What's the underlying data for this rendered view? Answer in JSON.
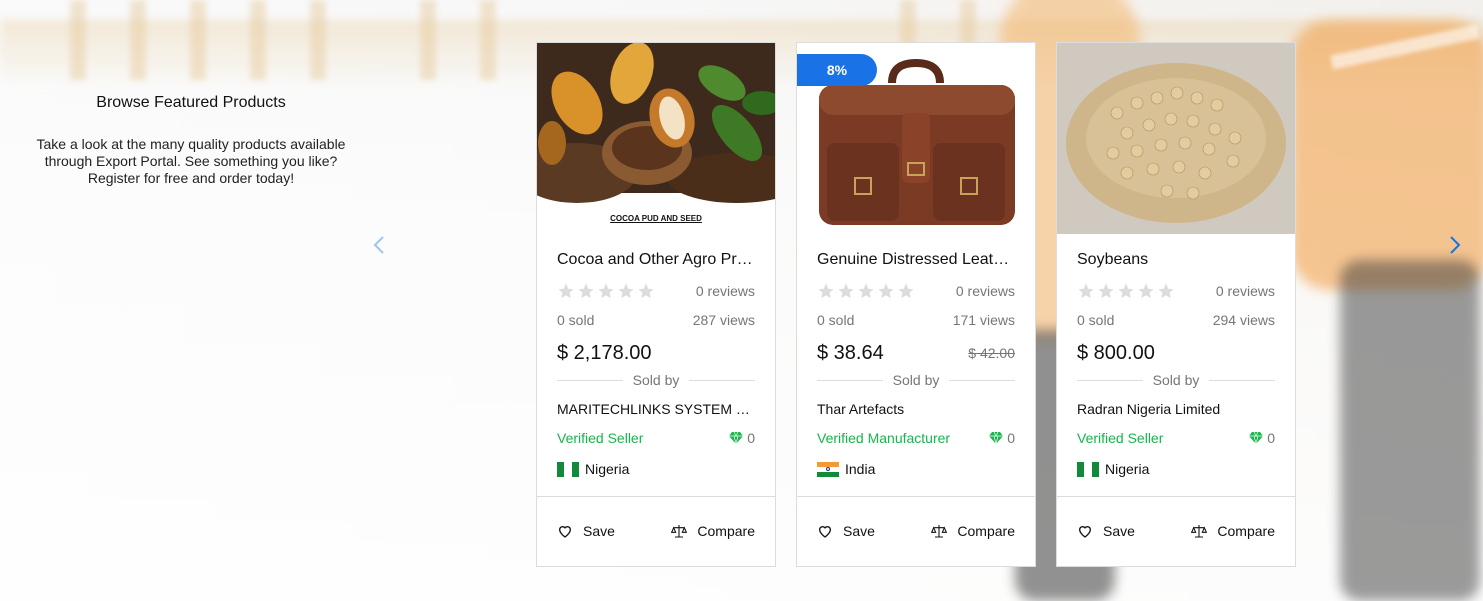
{
  "intro": {
    "title": "Browse Featured Products",
    "text": "Take a look at the many quality products available through Export Portal. See something you like? Register for free and order today!"
  },
  "nav": {
    "prev_icon": "chevron-left-icon",
    "next_icon": "chevron-right-icon"
  },
  "colors": {
    "accent": "#1973e6",
    "verified": "#15b64b",
    "muted": "#767676"
  },
  "common": {
    "sold_by": "Sold by",
    "save": "Save",
    "compare": "Compare"
  },
  "products": [
    {
      "image_caption": "COCOA PUD AND SEED",
      "discount": "",
      "title": "Cocoa and Other Agro Products",
      "reviews": "0 reviews",
      "sold": "0 sold",
      "views": "287 views",
      "price": "$ 2,178.00",
      "old_price": "",
      "seller": "MARITECHLINKS SYSTEM VENTURES",
      "verification": "Verified Seller",
      "gems": "0",
      "country": "Nigeria",
      "flag": "nigeria"
    },
    {
      "image_caption": "",
      "discount": "8%",
      "title": "Genuine Distressed Leather Bag",
      "reviews": "0 reviews",
      "sold": "0 sold",
      "views": "171 views",
      "price": "$ 38.64",
      "old_price": "$ 42.00",
      "seller": "Thar Artefacts",
      "verification": "Verified Manufacturer",
      "gems": "0",
      "country": "India",
      "flag": "india"
    },
    {
      "image_caption": "",
      "discount": "",
      "title": "Soybeans",
      "reviews": "0 reviews",
      "sold": "0 sold",
      "views": "294 views",
      "price": "$ 800.00",
      "old_price": "",
      "seller": "Radran Nigeria Limited",
      "verification": "Verified Seller",
      "gems": "0",
      "country": "Nigeria",
      "flag": "nigeria"
    }
  ]
}
